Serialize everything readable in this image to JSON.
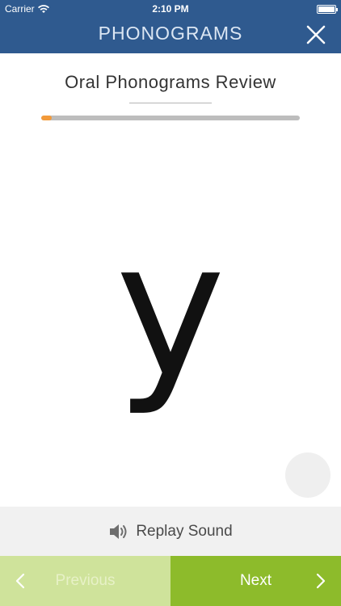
{
  "status_bar": {
    "carrier": "Carrier",
    "time": "2:10 PM"
  },
  "nav": {
    "title": "PHONOGRAMS"
  },
  "lesson": {
    "title": "Oral Phonograms Review",
    "progress_fraction": 0.04
  },
  "card": {
    "phonogram": "y"
  },
  "replay": {
    "label": "Replay Sound"
  },
  "navigation": {
    "previous_label": "Previous",
    "next_label": "Next"
  },
  "colors": {
    "nav_bg": "#2f5a8f",
    "progress": "#f39a3a",
    "next_bg": "#8dbb2b",
    "previous_bg": "#cfe39b"
  }
}
